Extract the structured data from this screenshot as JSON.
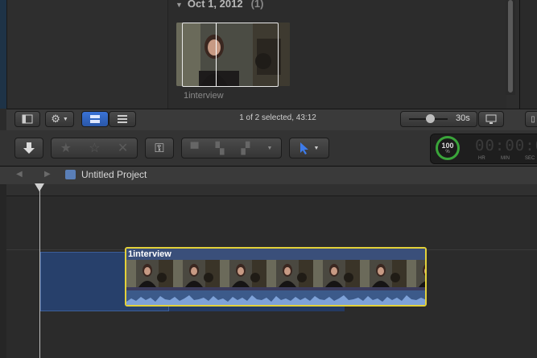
{
  "browser": {
    "date_label": "Oct 1, 2012",
    "date_count": "(1)",
    "clip_name": "1interview"
  },
  "footer": {
    "status": "1 of 2 selected, 43:12",
    "duration": "30s"
  },
  "toolbar": {
    "meter_value": "100",
    "meter_unit": "%",
    "timecode_labels": [
      "HR",
      "MIN",
      "SEC"
    ]
  },
  "timeline": {
    "project_title": "Untitled Project",
    "clip_title": "1interview"
  },
  "colors": {
    "selection_yellow": "#e3d13a",
    "active_blue": "#2f66c8",
    "meter_green": "#3aa53a"
  }
}
